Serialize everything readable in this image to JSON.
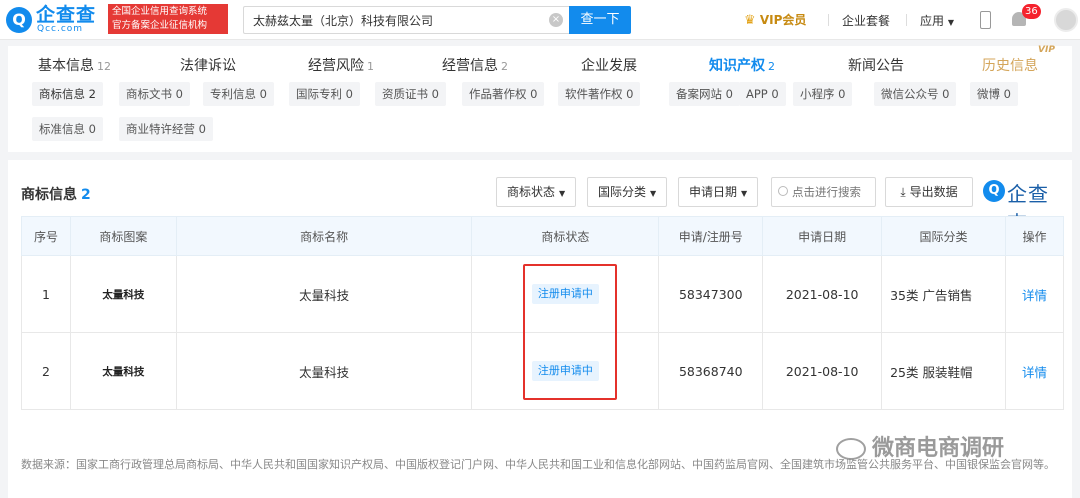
{
  "header": {
    "logo_text": "企查查",
    "logo_domain": "Qcc.com",
    "badge_line1": "全国企业信用查询系统",
    "badge_line2": "官方备案企业征信机构",
    "search_value": "太赫兹太量（北京）科技有限公司",
    "search_button": "查一下",
    "vip_label": "VIP会员",
    "package_label": "企业套餐",
    "app_label": "应用",
    "notification_count": "36"
  },
  "tabs": [
    {
      "label": "基本信息",
      "count": "12"
    },
    {
      "label": "法律诉讼",
      "count": ""
    },
    {
      "label": "经营风险",
      "count": "1"
    },
    {
      "label": "经营信息",
      "count": "2"
    },
    {
      "label": "企业发展",
      "count": ""
    },
    {
      "label": "知识产权",
      "count": "2"
    },
    {
      "label": "新闻公告",
      "count": ""
    },
    {
      "label": "历史信息",
      "count": ""
    }
  ],
  "vip_tag": "VIP",
  "subtags": [
    "商标信息 2",
    "商标文书 0",
    "专利信息 0",
    "国际专利 0",
    "资质证书 0",
    "作品著作权 0",
    "软件著作权 0",
    "备案网站 0",
    "APP 0",
    "小程序 0",
    "微信公众号 0",
    "微博 0",
    "标准信息 0",
    "商业特许经营 0"
  ],
  "section": {
    "title": "商标信息",
    "count": "2",
    "filter_status": "商标状态",
    "filter_class": "国际分类",
    "filter_date": "申请日期",
    "search_placeholder": "点击进行搜索",
    "export_label": "导出数据",
    "brand_text": "企查查"
  },
  "table": {
    "headers": [
      "序号",
      "商标图案",
      "商标名称",
      "商标状态",
      "申请/注册号",
      "申请日期",
      "国际分类",
      "操作"
    ],
    "rows": [
      {
        "no": "1",
        "image": "太量科技",
        "name": "太量科技",
        "status": "注册申请中",
        "reg_no": "58347300",
        "date": "2021-08-10",
        "class": "35类 广告销售",
        "action": "详情"
      },
      {
        "no": "2",
        "image": "太量科技",
        "name": "太量科技",
        "status": "注册申请中",
        "reg_no": "58368740",
        "date": "2021-08-10",
        "class": "25类 服装鞋帽",
        "action": "详情"
      }
    ]
  },
  "footer_text": "数据来源：国家工商行政管理总局商标局、中华人民共和国国家知识产权局、中国版权登记门户网、中华人民共和国工业和信息化部网站、中国药监局官网、全国建筑市场监管公共服务平台、中国银保监会官网等。",
  "watermark": "微商电商调研",
  "colors": {
    "accent": "#128bed",
    "badge_red": "#e53935",
    "vip_gold": "#c78a11",
    "highlight_box": "#e4312b"
  }
}
